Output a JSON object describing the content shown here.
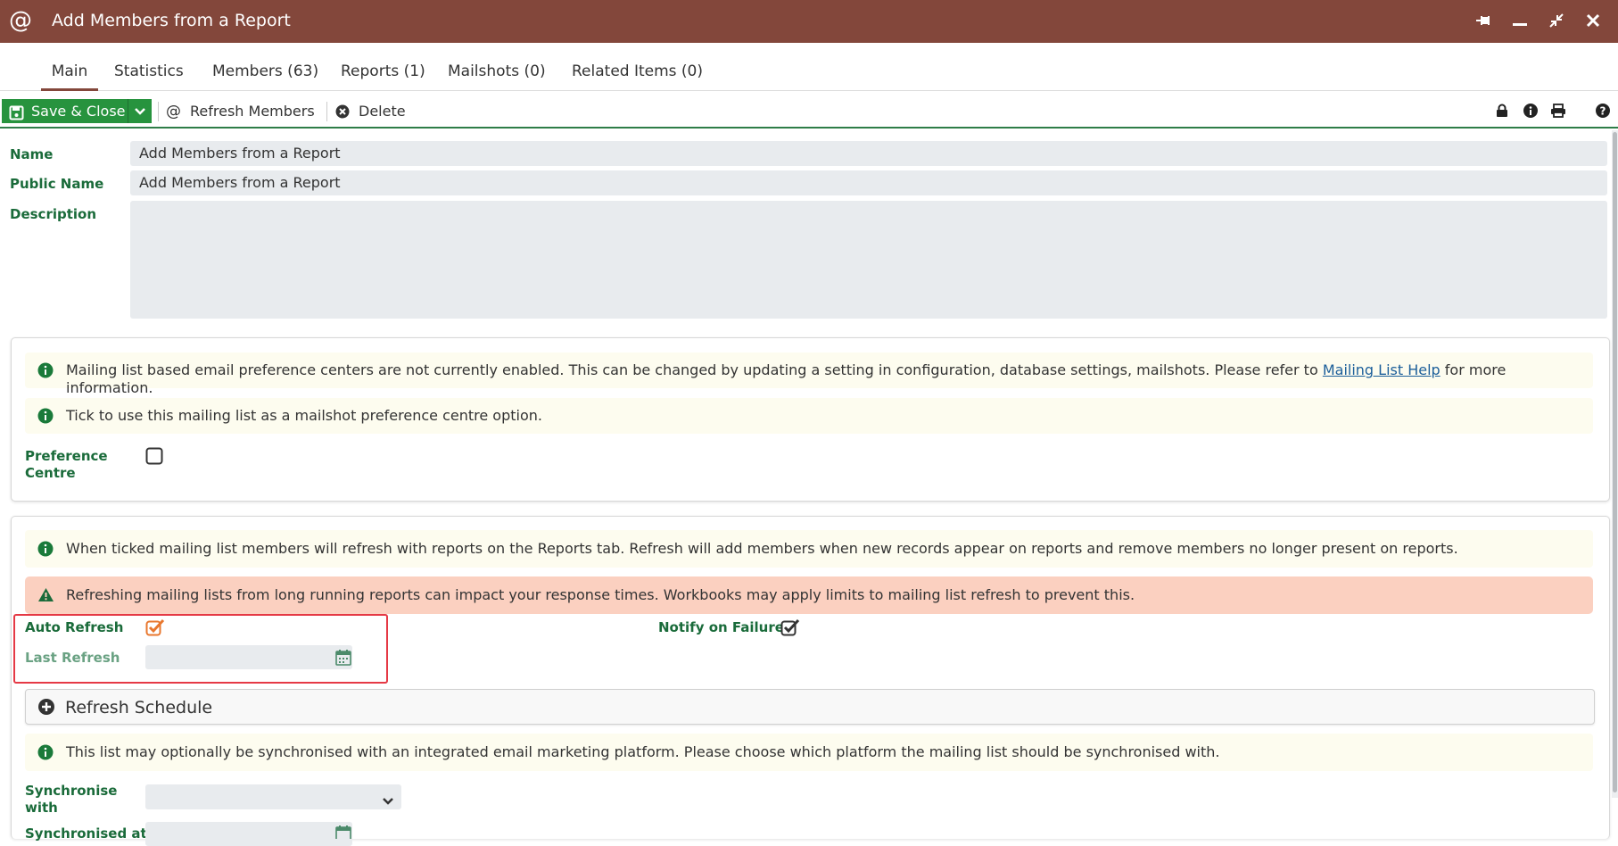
{
  "window": {
    "title": "Add Members from a Report",
    "app_icon_glyph": "@",
    "controls": [
      "pin-icon",
      "minimize-icon",
      "restore-icon",
      "close-icon"
    ],
    "header_color": "#83473b"
  },
  "tabs": [
    {
      "label": "Main",
      "active": true
    },
    {
      "label": "Statistics",
      "active": false
    },
    {
      "label": "Members (63)",
      "active": false
    },
    {
      "label": "Reports (1)",
      "active": false
    },
    {
      "label": "Mailshots (0)",
      "active": false
    },
    {
      "label": "Related Items (0)",
      "active": false
    }
  ],
  "toolbar": {
    "save_label": "Save & Close",
    "refresh_members_label": "Refresh Members",
    "refresh_glyph": "@",
    "delete_label": "Delete",
    "right_icons": [
      "lock-icon",
      "info-icon",
      "print-icon",
      "help-icon"
    ]
  },
  "form": {
    "name_label": "Name",
    "name_value": "Add Members from a Report",
    "public_name_label": "Public Name",
    "public_name_value": "Add Members from a Report",
    "description_label": "Description",
    "description_value": ""
  },
  "preference_panel": {
    "info1_before": "Mailing list based email preference centers are not currently enabled. This can be changed by updating a setting in configuration, database settings, mailshots. Please refer to",
    "info1_link": "Mailing List Help",
    "info1_after": "for more information.",
    "info2": "Tick to use this mailing list as a mailshot preference centre option.",
    "preference_centre_label_1": "Preference",
    "preference_centre_label_2": "Centre",
    "preference_centre_checked": false
  },
  "refresh_panel": {
    "info": "When ticked mailing list members will refresh with reports on the Reports tab. Refresh will add members when new records appear on reports and remove members no longer present on reports.",
    "warning": "Refreshing mailing lists from long running reports can impact your response times. Workbooks may apply limits to mailing list refresh to prevent this.",
    "auto_refresh_label": "Auto Refresh",
    "auto_refresh_checked": true,
    "last_refresh_label": "Last Refresh",
    "last_refresh_value": "",
    "notify_label": "Notify on Failure",
    "notify_checked": true,
    "schedule_label": "Refresh Schedule",
    "sync_info": "This list may optionally be synchronised with an integrated email marketing platform. Please choose which platform the mailing list should be synchronised with.",
    "sync_label_1": "Synchronise",
    "sync_label_2": "with",
    "sync_value": "",
    "synced_at_label": "Synchronised at"
  },
  "colors": {
    "accent_green": "#27933e",
    "label_green": "#1a6b3a",
    "checkbox_orange": "#e8772e",
    "warning_bg": "#fbd0c0",
    "info_bg": "#fdfcef",
    "highlight_red": "#e53945"
  }
}
